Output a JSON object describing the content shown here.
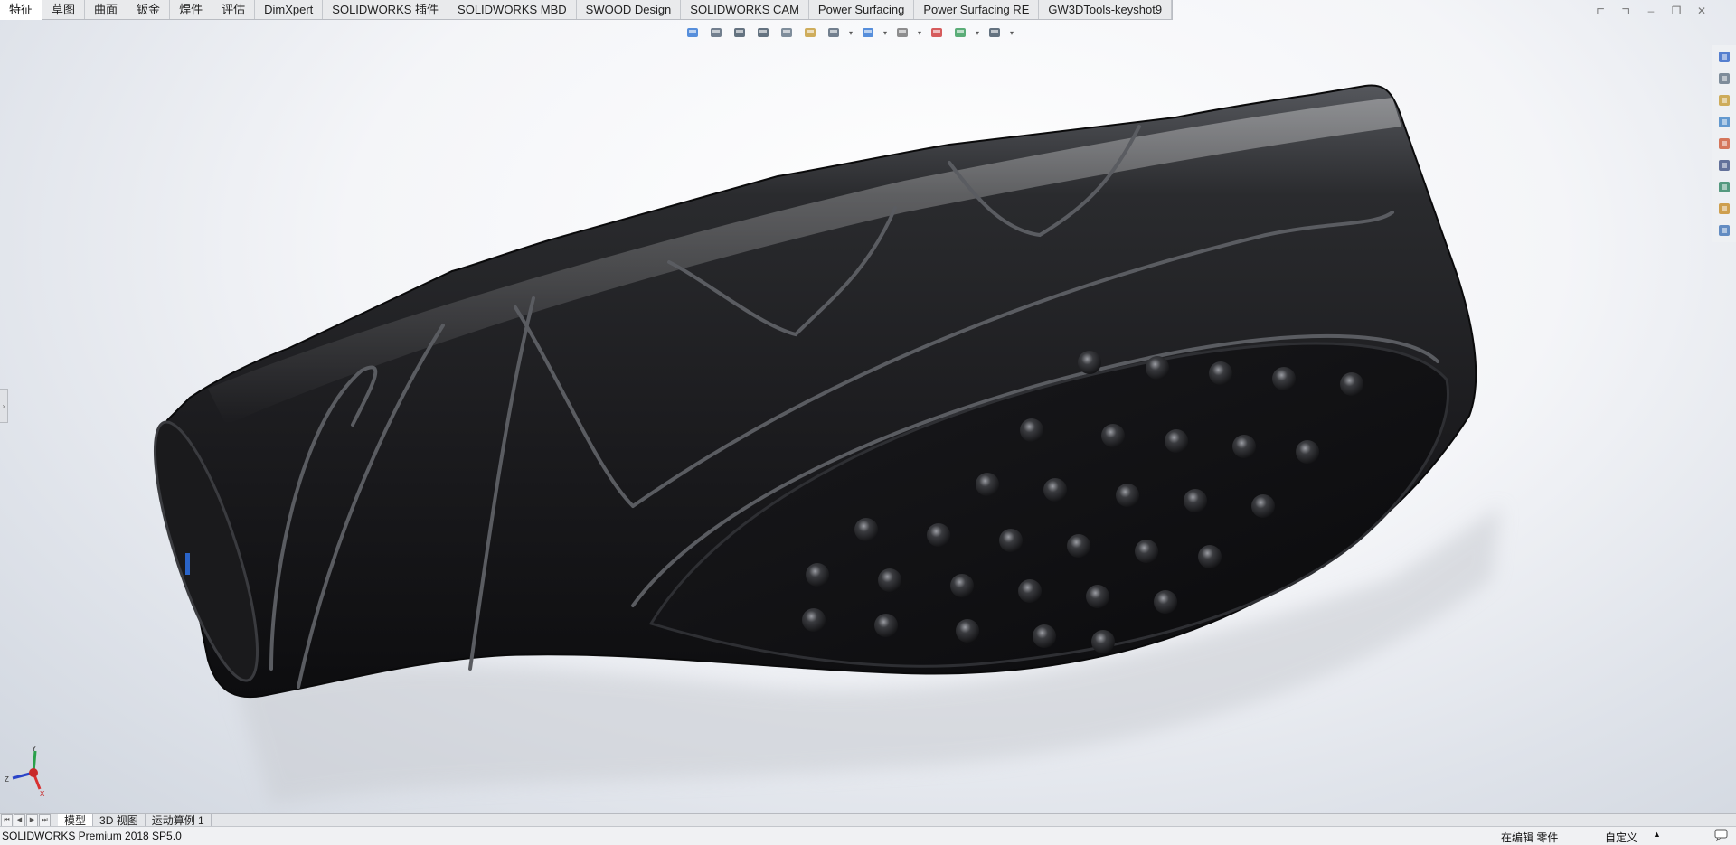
{
  "command_tabs": [
    {
      "label": "特征",
      "active": true
    },
    {
      "label": "草图",
      "active": false
    },
    {
      "label": "曲面",
      "active": false
    },
    {
      "label": "钣金",
      "active": false
    },
    {
      "label": "焊件",
      "active": false
    },
    {
      "label": "评估",
      "active": false
    },
    {
      "label": "DimXpert",
      "active": false
    },
    {
      "label": "SOLIDWORKS 插件",
      "active": false
    },
    {
      "label": "SOLIDWORKS MBD",
      "active": false
    },
    {
      "label": "SWOOD Design",
      "active": false
    },
    {
      "label": "SOLIDWORKS CAM",
      "active": false
    },
    {
      "label": "Power Surfacing",
      "active": false
    },
    {
      "label": "Power Surfacing RE",
      "active": false
    },
    {
      "label": "GW3DTools-keyshot9",
      "active": false
    }
  ],
  "headsup_toolbar": [
    {
      "name": "view-orientation-icon"
    },
    {
      "name": "previous-view-icon"
    },
    {
      "name": "zoom-to-fit-icon"
    },
    {
      "name": "zoom-to-area-icon"
    },
    {
      "name": "section-view-icon"
    },
    {
      "name": "dynamic-annotation-icon"
    },
    {
      "name": "view-settings-icon"
    },
    {
      "name": "display-style-icon"
    },
    {
      "name": "hide-show-items-icon"
    },
    {
      "name": "edit-appearance-icon"
    },
    {
      "name": "apply-scene-icon"
    },
    {
      "name": "view-display-icon"
    }
  ],
  "taskpane_icons": [
    "solidworks-resources-icon",
    "design-library-icon",
    "file-explorer-icon",
    "view-palette-icon",
    "appearances-scenes-icon",
    "custom-properties-icon",
    "solidworks-forum-icon",
    "search-icon",
    "chat-icon"
  ],
  "triad": {
    "x": "X",
    "y": "Y",
    "z": "Z"
  },
  "model_tabs": [
    {
      "label": "模型",
      "active": true
    },
    {
      "label": "3D 视图",
      "active": false
    },
    {
      "label": "运动算例 1",
      "active": false
    }
  ],
  "status": {
    "product": "SOLIDWORKS Premium 2018 SP5.0",
    "mode": "在编辑 零件",
    "units": "自定义",
    "units_caret": "▲",
    "help_icon": "speech-bubble-icon"
  },
  "colors": {
    "part_body": "#1e1e20",
    "accent_blue": "#2a64c8"
  }
}
